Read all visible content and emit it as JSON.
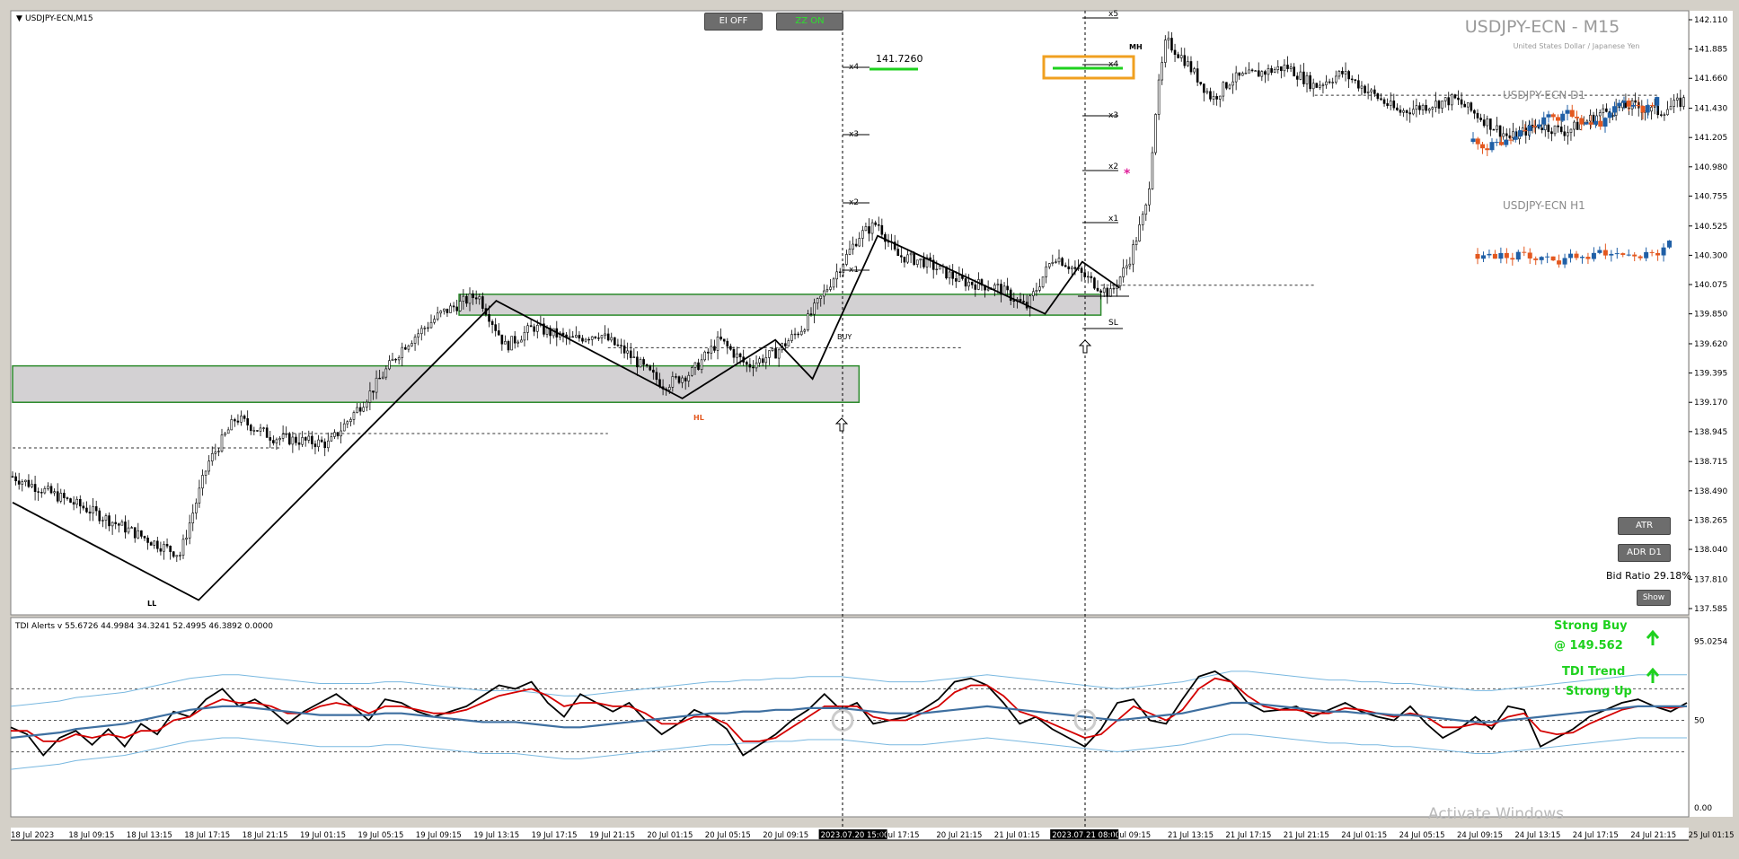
{
  "symbol_label": "USDJPY-ECN,M15",
  "watermark_title": "USDJPY-ECN - M15",
  "watermark_subtitle": "United States Dollar / Japanese Yen",
  "mini_d1_label": "USDJPY-ECN D1",
  "mini_h1_label": "USDJPY-ECN H1",
  "buttons": {
    "ei": "EI OFF",
    "zz": "ZZ ON",
    "atr": "ATR",
    "adr": "ADR D1",
    "show": "Show"
  },
  "bid_ratio": "Bid Ratio 29.18%",
  "target_price_label": "141.7260",
  "markers": {
    "ll": "LL",
    "hl": "HL",
    "sl": "SL",
    "buy": "BUY",
    "mh": "MH"
  },
  "level_labels": [
    "x1",
    "x2",
    "x3",
    "x4",
    "x5"
  ],
  "tdi_header": "TDI Alerts v 55.6726 44.9984 34.3241 52.4995 46.3892 0.0000",
  "tdi_signals": {
    "strong_buy": "Strong Buy",
    "strong_buy_price": "@ 149.562",
    "trend": "TDI Trend",
    "trend_state": "Strong Up"
  },
  "activate_windows": "Activate Windows",
  "colors": {
    "bull": "#1f5fa6",
    "bear": "#e3581f",
    "fast": "#d40000",
    "mid": "#3e6fa0",
    "band": "#79b8e0",
    "signal": "#1ed11e",
    "box": "#2a8a2a",
    "highlight": "#f0a020"
  },
  "chart_data": [
    {
      "type": "candlestick",
      "title": "USDJPY-ECN,M15",
      "ylim": [
        137.585,
        142.11
      ],
      "y_ticks": [
        "142.110",
        "141.885",
        "141.660",
        "141.430",
        "141.205",
        "140.980",
        "140.755",
        "140.525",
        "140.300",
        "140.075",
        "139.850",
        "139.620",
        "139.395",
        "139.170",
        "138.945",
        "138.715",
        "138.490",
        "138.265",
        "138.040",
        "137.810",
        "137.585"
      ],
      "x_ticks": [
        "18 Jul 2023",
        "18 Jul 09:15",
        "18 Jul 13:15",
        "18 Jul 17:15",
        "18 Jul 21:15",
        "19 Jul 01:15",
        "19 Jul 05:15",
        "19 Jul 09:15",
        "19 Jul 13:15",
        "19 Jul 17:15",
        "19 Jul 21:15",
        "20 Jul 01:15",
        "20 Jul 05:15",
        "20 Jul 09:15",
        "2023.07.20 15:00",
        "0 Jul 17:15",
        "20 Jul 21:15",
        "21 Jul 01:15",
        "2023.07.21 08:00",
        "1 Jul 09:15",
        "21 Jul 13:15",
        "21 Jul 17:15",
        "21 Jul 21:15",
        "24 Jul 01:15",
        "24 Jul 05:15",
        "24 Jul 09:15",
        "24 Jul 13:15",
        "24 Jul 17:15",
        "24 Jul 21:15",
        "25 Jul 01:15"
      ],
      "close_path": [
        [
          0,
          138.6
        ],
        [
          8,
          138.35
        ],
        [
          15,
          138.1
        ],
        [
          18,
          138.0
        ],
        [
          21,
          138.7
        ],
        [
          24,
          139.05
        ],
        [
          28,
          138.9
        ],
        [
          34,
          138.85
        ],
        [
          38,
          139.2
        ],
        [
          42,
          139.6
        ],
        [
          46,
          139.85
        ],
        [
          50,
          140.0
        ],
        [
          53,
          139.6
        ],
        [
          56,
          139.75
        ],
        [
          60,
          139.65
        ],
        [
          63,
          139.7
        ],
        [
          66,
          139.55
        ],
        [
          70,
          139.3
        ],
        [
          73,
          139.4
        ],
        [
          76,
          139.65
        ],
        [
          79,
          139.45
        ],
        [
          82,
          139.55
        ],
        [
          85,
          139.75
        ],
        [
          88,
          140.1
        ],
        [
          91,
          140.45
        ],
        [
          93,
          140.55
        ],
        [
          95,
          140.3
        ],
        [
          98,
          140.25
        ],
        [
          102,
          140.1
        ],
        [
          106,
          140.05
        ],
        [
          109,
          139.9
        ],
        [
          112,
          140.3
        ],
        [
          115,
          140.15
        ],
        [
          118,
          140.0
        ],
        [
          120,
          140.25
        ],
        [
          122,
          140.7
        ],
        [
          123,
          141.5
        ],
        [
          124,
          141.95
        ],
        [
          126,
          141.8
        ],
        [
          129,
          141.5
        ],
        [
          131,
          141.65
        ],
        [
          134,
          141.7
        ],
        [
          137,
          141.75
        ],
        [
          140,
          141.6
        ],
        [
          143,
          141.7
        ],
        [
          146,
          141.55
        ],
        [
          149,
          141.4
        ],
        [
          152,
          141.45
        ],
        [
          155,
          141.5
        ],
        [
          158,
          141.35
        ],
        [
          161,
          141.2
        ],
        [
          164,
          141.3
        ],
        [
          167,
          141.25
        ],
        [
          171,
          141.4
        ],
        [
          174,
          141.45
        ],
        [
          177,
          141.4
        ],
        [
          180,
          141.5
        ]
      ],
      "zigzag": [
        [
          0,
          138.4
        ],
        [
          20,
          137.65
        ],
        [
          52,
          139.95
        ],
        [
          72,
          139.2
        ],
        [
          82,
          139.65
        ],
        [
          86,
          139.35
        ],
        [
          93,
          140.45
        ],
        [
          111,
          139.85
        ],
        [
          115,
          140.25
        ],
        [
          119,
          140.05
        ]
      ],
      "zones": [
        {
          "from": 0,
          "to": 91,
          "low": 139.17,
          "high": 139.45
        },
        {
          "from": 48,
          "to": 117,
          "low": 139.84,
          "high": 140.0
        }
      ],
      "dashed_levels": [
        {
          "from": 0,
          "to": 29,
          "y": 138.82
        },
        {
          "from": 29,
          "to": 64,
          "y": 138.93
        },
        {
          "from": 64,
          "to": 102,
          "y": 139.59
        },
        {
          "from": 117,
          "to": 140,
          "y": 140.07
        },
        {
          "from": 140,
          "to": 177,
          "y": 141.53
        }
      ],
      "target_price": 141.726
    },
    {
      "type": "line",
      "title": "TDI Alerts",
      "ylim": [
        0,
        100
      ],
      "y_ticks": [
        "95.0254",
        "50",
        "0.00"
      ],
      "levels": [
        68,
        50,
        32
      ],
      "series": [
        {
          "values": [
            46,
            42,
            30,
            40,
            44,
            36,
            45,
            35,
            48,
            42,
            55,
            52,
            62,
            68,
            58,
            62,
            56,
            48,
            55,
            60,
            65,
            58,
            50,
            62,
            60,
            55,
            52,
            55,
            58,
            64,
            70,
            68,
            72,
            60,
            52,
            65,
            60,
            55,
            60,
            50,
            42,
            48,
            56,
            52,
            45,
            30,
            36,
            42,
            50,
            56,
            65,
            56,
            60,
            48,
            50,
            52,
            56,
            62,
            72,
            74,
            70,
            60,
            48,
            52,
            45,
            40,
            35,
            45,
            60,
            62,
            50,
            48,
            62,
            75,
            78,
            72,
            60,
            55,
            56,
            58,
            52,
            56,
            60,
            55,
            52,
            50,
            58,
            48,
            40,
            45,
            52,
            45,
            58,
            56,
            35,
            40,
            45,
            52,
            56,
            60,
            62,
            58,
            55,
            60
          ]
        },
        {
          "values": [
            44,
            44,
            38,
            38,
            42,
            40,
            42,
            40,
            44,
            44,
            50,
            52,
            58,
            62,
            60,
            60,
            58,
            54,
            54,
            58,
            60,
            58,
            54,
            58,
            58,
            56,
            54,
            54,
            56,
            60,
            64,
            66,
            68,
            64,
            58,
            60,
            60,
            58,
            58,
            54,
            48,
            48,
            52,
            52,
            48,
            38,
            38,
            40,
            46,
            52,
            58,
            58,
            58,
            52,
            50,
            50,
            54,
            58,
            66,
            70,
            70,
            64,
            55,
            52,
            48,
            44,
            40,
            42,
            50,
            58,
            54,
            50,
            56,
            68,
            74,
            72,
            64,
            58,
            56,
            56,
            54,
            54,
            57,
            56,
            54,
            52,
            54,
            52,
            46,
            46,
            48,
            47,
            52,
            54,
            44,
            42,
            43,
            48,
            52,
            56,
            58,
            58,
            57,
            58
          ]
        },
        {
          "values": [
            40,
            41,
            42,
            43,
            45,
            46,
            47,
            48,
            50,
            52,
            54,
            56,
            57,
            58,
            58,
            57,
            56,
            55,
            54,
            53,
            53,
            53,
            53,
            54,
            54,
            53,
            52,
            51,
            50,
            49,
            49,
            49,
            48,
            47,
            46,
            46,
            47,
            48,
            49,
            50,
            51,
            52,
            53,
            54,
            54,
            55,
            55,
            56,
            56,
            57,
            57,
            57,
            56,
            55,
            54,
            54,
            54,
            55,
            56,
            57,
            58,
            57,
            56,
            55,
            54,
            53,
            52,
            51,
            50,
            51,
            52,
            53,
            54,
            56,
            58,
            60,
            60,
            59,
            58,
            57,
            56,
            55,
            55,
            54,
            54,
            53,
            53,
            52,
            51,
            50,
            49,
            49,
            50,
            51,
            52,
            53,
            54,
            55,
            56,
            57,
            58,
            58,
            58,
            58
          ]
        }
      ]
    }
  ]
}
